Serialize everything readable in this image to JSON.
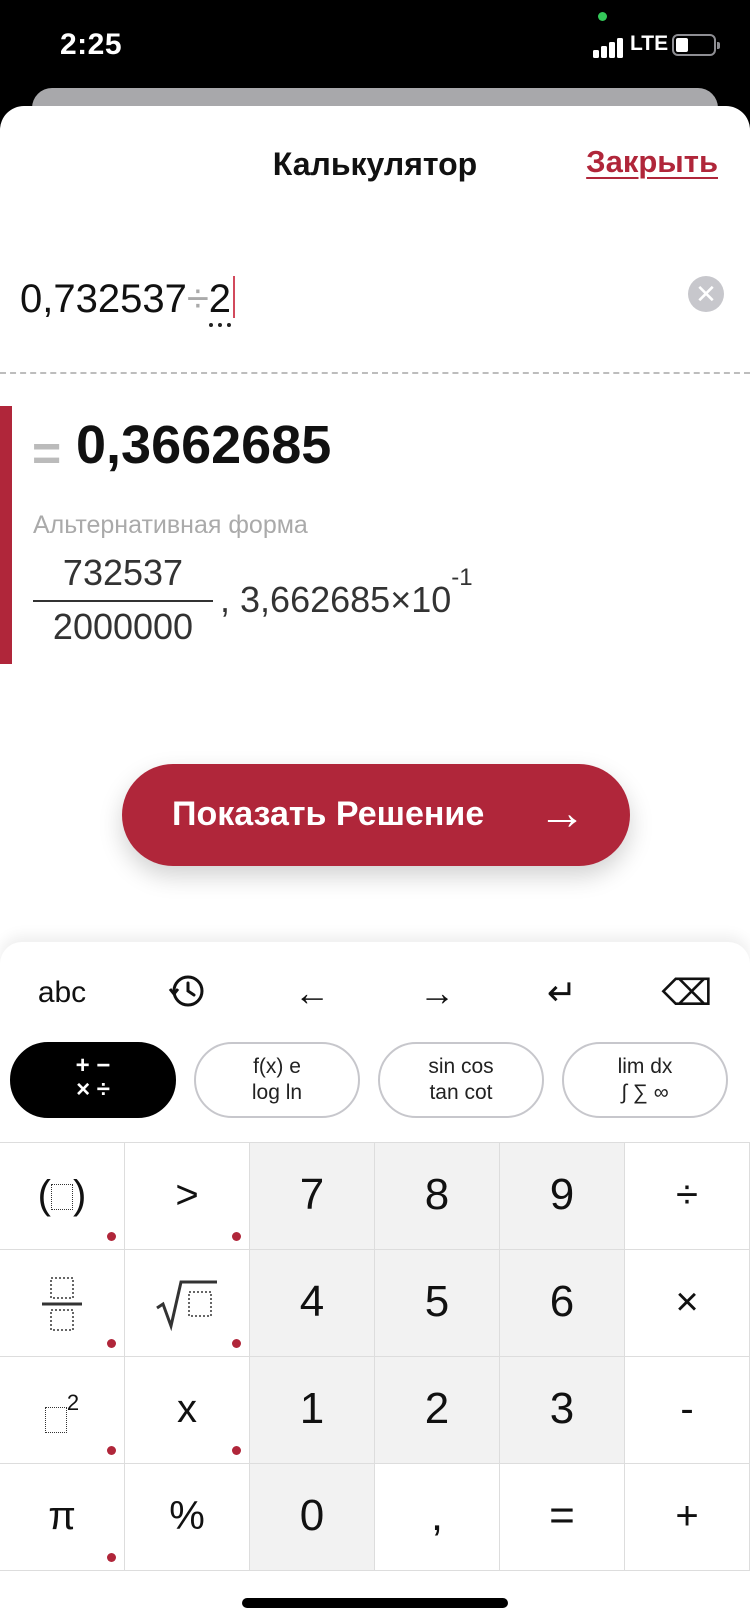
{
  "status_bar": {
    "time": "2:25",
    "network": "LTE"
  },
  "header": {
    "title": "Калькулятор",
    "close_label": "Закрыть"
  },
  "expression": {
    "left": "0,732537",
    "operator": "÷",
    "right": "2"
  },
  "result": {
    "equals": "=",
    "value": "0,3662685",
    "alt_label": "Альтернативная форма",
    "fraction_numerator": "732537",
    "fraction_denominator": "2000000",
    "alt_separator": ",",
    "scientific_mantissa": "3,662685",
    "scientific_times": "×",
    "scientific_base": "10",
    "scientific_exp": "-1"
  },
  "solution_button": {
    "label": "Показать Решение",
    "arrow": "→"
  },
  "keyboard": {
    "toolbar": {
      "abc": "abc",
      "left": "←",
      "right": "→",
      "enter": "↵",
      "backspace": "⌫"
    },
    "tabs": [
      {
        "line1": "+ −",
        "line2": "× ÷"
      },
      {
        "line1": "f(x)  e",
        "line2": "log  ln"
      },
      {
        "line1": "sin cos",
        "line2": "tan cot"
      },
      {
        "line1": "lim   dx",
        "line2": "∫ ∑ ∞"
      }
    ],
    "keys": {
      "paren": "( )",
      "gt": ">",
      "k7": "7",
      "k8": "8",
      "k9": "9",
      "div": "÷",
      "k4": "4",
      "k5": "5",
      "k6": "6",
      "mul": "×",
      "sup2": "2",
      "x": "x",
      "k1": "1",
      "k2": "2",
      "k3": "3",
      "minus": "-",
      "pi": "π",
      "percent": "%",
      "k0": "0",
      "comma": ",",
      "eq": "=",
      "plus": "+"
    }
  },
  "colors": {
    "accent": "#b0263a",
    "active_tab": "#000000"
  }
}
